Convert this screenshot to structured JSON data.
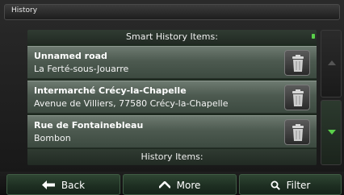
{
  "header": {
    "title": "History"
  },
  "list": {
    "smart_header": "Smart History Items:",
    "history_header": "History Items:",
    "items": [
      {
        "name": "Unnamed road",
        "address": "La Ferté-sous-Jouarre"
      },
      {
        "name": "Intermarché Crécy-la-Chapelle",
        "address": "Avenue de Villiers, 77580 Crécy-la-Chapelle"
      },
      {
        "name": "Rue de Fontainebleau",
        "address": "Bombon"
      }
    ]
  },
  "toolbar": {
    "back_label": "Back",
    "more_label": "More",
    "filter_label": "Filter"
  },
  "icons": {
    "back": "arrow-left-icon",
    "more": "chevron-up-icon",
    "filter": "magnifier-icon",
    "delete": "trash-icon",
    "scroll_up": "arrow-up-icon",
    "scroll_down": "arrow-down-icon"
  },
  "colors": {
    "accent": "#5ad14a",
    "item_bg": "#5a675d",
    "button_bg": "#1e2f22"
  }
}
